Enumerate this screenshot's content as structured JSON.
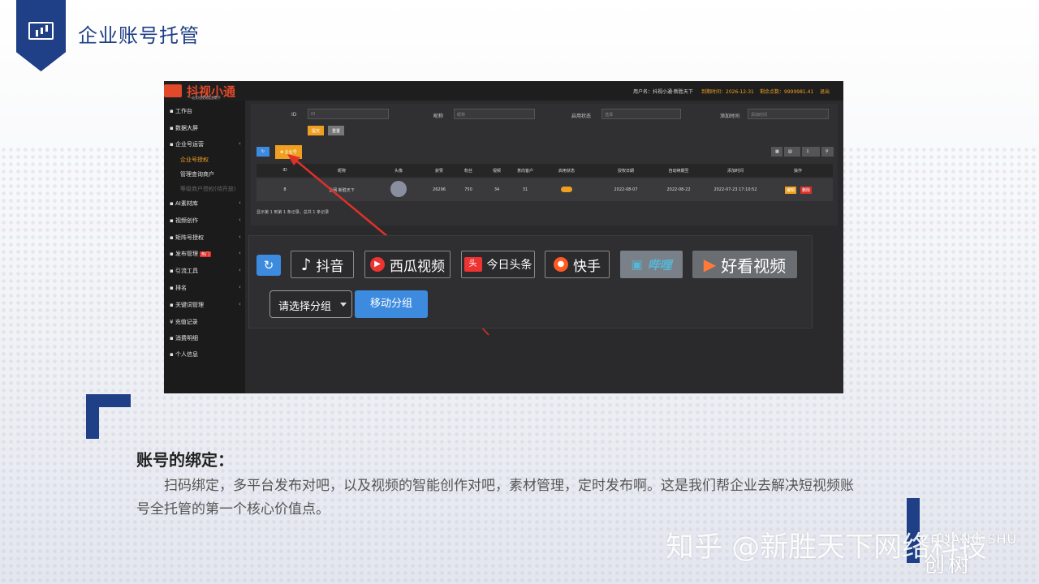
{
  "header": {
    "title": "企业账号托管"
  },
  "app": {
    "brand": "抖视小通",
    "brand_sub": "一站式短视频运营助手",
    "top": {
      "user": "用户名：抖视小通·新胜天下",
      "expire": "到期时间：2026-12-31",
      "balance": "剩余点数：9999981.41",
      "logout": "退出"
    },
    "sidebar": [
      {
        "label": "工作台"
      },
      {
        "label": "数据大屏"
      },
      {
        "label": "企业号运营"
      },
      {
        "label": "企业号授权"
      },
      {
        "label": "管理查询商户"
      },
      {
        "label": "等级商户授权(待开放)"
      },
      {
        "label": "AI素材库"
      },
      {
        "label": "视频创作"
      },
      {
        "label": "矩阵号授权"
      },
      {
        "label": "发布管理",
        "badge": "热门"
      },
      {
        "label": "引流工具"
      },
      {
        "label": "排名"
      },
      {
        "label": "关键词管理"
      },
      {
        "label": "充值记录"
      },
      {
        "label": "消费明细"
      },
      {
        "label": "个人信息"
      }
    ],
    "filters": {
      "id_label": "ID",
      "id_placeholder": "ID",
      "nick_label": "昵称",
      "nick_placeholder": "昵称",
      "status_label": "启用状态",
      "status_value": "选择",
      "time_label": "添加时间",
      "time_placeholder": "添加时间",
      "search": "提交",
      "reset": "重置"
    },
    "add_button": "企业号",
    "table": {
      "headers": [
        "ID",
        "昵称",
        "头像",
        "获赞",
        "粉丝",
        "视频",
        "意向客户",
        "启用状态",
        "授权日期",
        "自动续期至",
        "添加时间",
        "操作"
      ],
      "row": [
        "8",
        "企网·新胜天下",
        "",
        "26296",
        "750",
        "34",
        "31",
        "",
        "2022-08-07",
        "2022-08-22",
        "2022-07-23 17:10:52",
        ""
      ],
      "actions": [
        "编辑",
        "删除"
      ]
    },
    "pager": "显示第 1 到第 1 条记录，总共 1 条记录"
  },
  "overlay": {
    "platforms": [
      "抖音",
      "西瓜视频",
      "今日头条",
      "快手",
      "哔哩",
      "好看视频"
    ],
    "group_placeholder": "请选择分组",
    "move_button": "移动分组"
  },
  "section": {
    "title": "账号的绑定：",
    "body": "扫码绑定，多平台发布对吧，以及视频的智能创作对吧，素材管理，定时发布啊。这是我们帮企业去解决短视频账号全托管的第一个核心价值点。"
  },
  "watermark": {
    "line1": "知乎 @新胜天下网络科技",
    "line2": "CHUANG SHU",
    "line3": "创树"
  },
  "colors": {
    "brand_blue": "#1f3f86",
    "accent_orange": "#f0a020",
    "button_blue": "#3d8bde"
  }
}
